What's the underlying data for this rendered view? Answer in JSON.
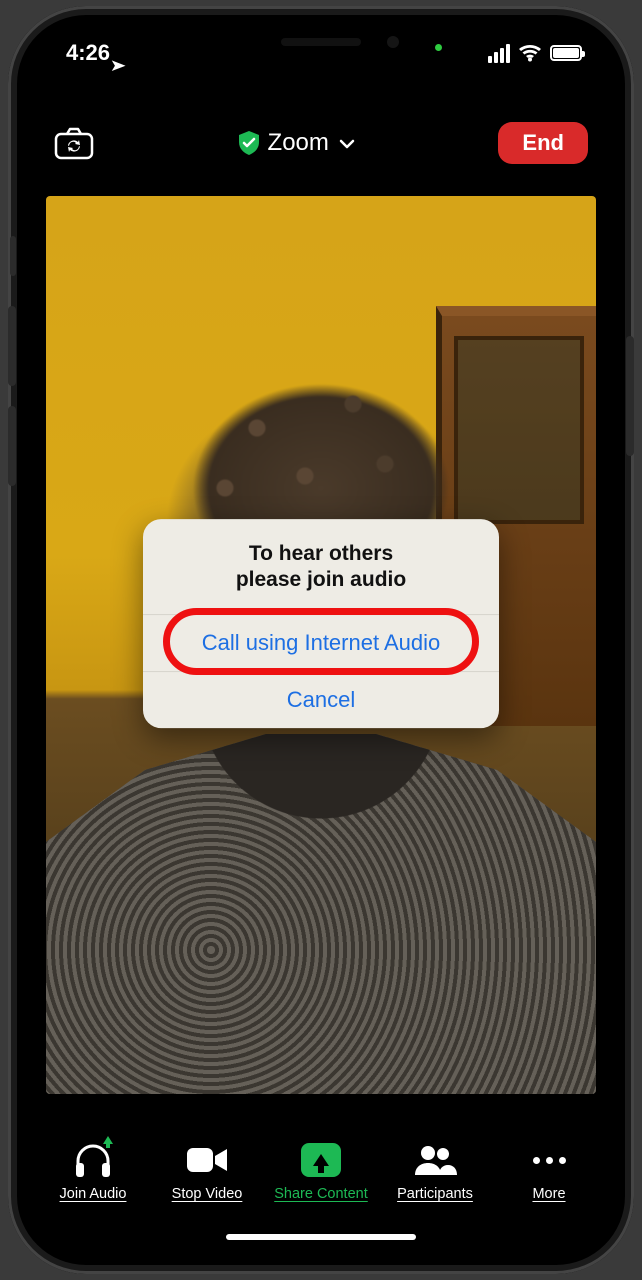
{
  "status": {
    "time": "4:26",
    "location_services": true
  },
  "top_bar": {
    "title": "Zoom",
    "end_label": "End"
  },
  "action_sheet": {
    "message_line1": "To hear others",
    "message_line2": "please join audio",
    "primary_label": "Call using Internet Audio",
    "cancel_label": "Cancel"
  },
  "bottom_bar": {
    "items": [
      {
        "id": "join-audio",
        "label": "Join Audio"
      },
      {
        "id": "stop-video",
        "label": "Stop Video"
      },
      {
        "id": "share-content",
        "label": "Share Content"
      },
      {
        "id": "participants",
        "label": "Participants"
      },
      {
        "id": "more",
        "label": "More"
      }
    ]
  },
  "annotations": {
    "highlighted_action": "Call using Internet Audio"
  }
}
